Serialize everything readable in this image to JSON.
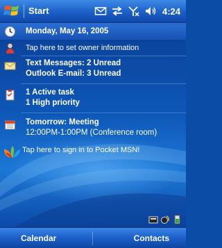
{
  "titlebar": {
    "start_label": "Start",
    "time": "4:24",
    "icons": [
      "windows-flag-icon",
      "inbox-icon",
      "sync-icon",
      "signal-off-icon",
      "volume-icon"
    ]
  },
  "today": {
    "date": "Monday, May 16, 2005",
    "owner": "Tap here to set owner information",
    "messages": {
      "line1": "Text Messages: 2 Unread",
      "line2": "Outlook E-mail: 3 Unread"
    },
    "tasks": {
      "line1": "1 Active task",
      "line2": "1 High priority"
    },
    "calendar": {
      "line1": "Tomorrow: Meeting",
      "line2": "12:00PM-1:00PM (Conference room)"
    },
    "msn": "Tap here to sign in to Pocket MSN!"
  },
  "softkeys": {
    "left": "Calendar",
    "right": "Contacts"
  },
  "colors": {
    "titlebar": "#1b5fc8",
    "background": "#0e58b8",
    "text": "#ffffff"
  }
}
